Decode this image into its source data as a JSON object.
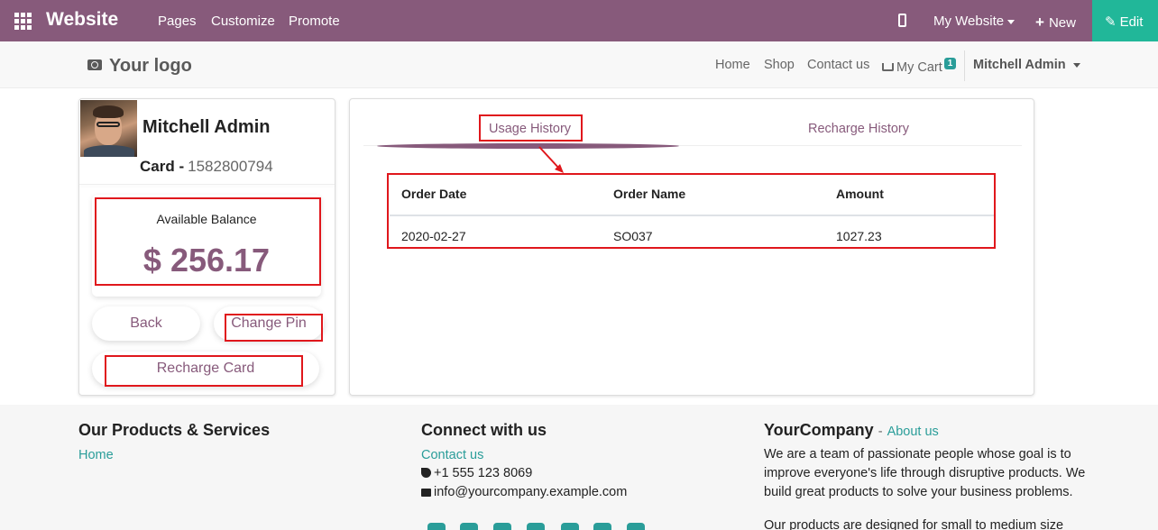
{
  "topbar": {
    "brand": "Website",
    "menu": [
      "Pages",
      "Customize",
      "Promote"
    ],
    "my_website": "My Website",
    "new_label": "New",
    "edit_label": "Edit"
  },
  "nav": {
    "logo": "Your logo",
    "links": [
      "Home",
      "Shop",
      "Contact us"
    ],
    "cart_label": "My Cart",
    "cart_count": "1",
    "user": "Mitchell Admin"
  },
  "card": {
    "name": "Mitchell Admin",
    "card_label": "Card -",
    "card_number": "1582800794",
    "balance_label": "Available Balance",
    "balance_value": "$ 256.17",
    "back_label": "Back",
    "change_pin_label": "Change Pin",
    "recharge_label": "Recharge Card"
  },
  "history": {
    "tabs": [
      "Usage History",
      "Recharge History"
    ],
    "columns": [
      "Order Date",
      "Order Name",
      "Amount"
    ],
    "rows": [
      [
        "2020-02-27",
        "SO037",
        "1027.23"
      ]
    ]
  },
  "footer": {
    "col1_title": "Our Products & Services",
    "col1_link": "Home",
    "col2_title": "Connect with us",
    "col2_contact": "Contact us",
    "phone": "+1 555 123 8069",
    "email": "info@yourcompany.example.com",
    "col3_title": "YourCompany",
    "col3_sep": "-",
    "about": "About us",
    "about_p1_l1": "We are a team of passionate people whose goal is to",
    "about_p1_l2": "improve everyone's life through disruptive products. We",
    "about_p1_l3": "build great products to solve your business problems.",
    "about_p2_l1": "Our products are designed for small to medium size"
  },
  "colors": {
    "brand": "#875a7b",
    "edit": "#21b799",
    "accent_link": "#2a9d99",
    "annotation": "#e0171c"
  }
}
